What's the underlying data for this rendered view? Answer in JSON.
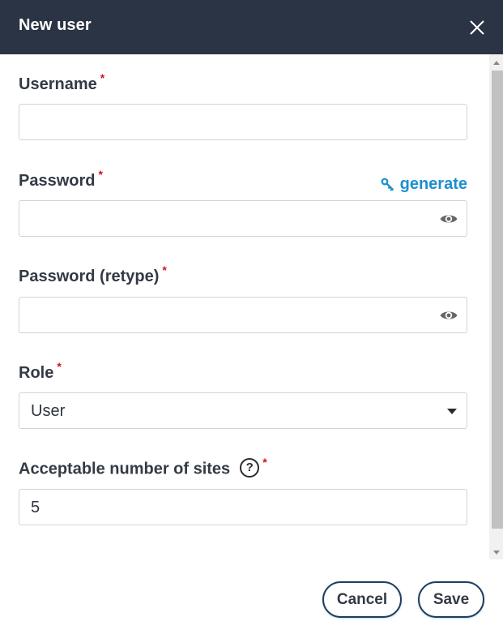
{
  "dialog": {
    "title": "New user",
    "close_icon": "close-icon"
  },
  "fields": {
    "username": {
      "label": "Username",
      "required": "*",
      "value": ""
    },
    "password": {
      "label": "Password",
      "required": "*",
      "value": "",
      "generate_label": "generate",
      "generate_icon": "key-icon",
      "toggle_icon": "eye-icon"
    },
    "password_retype": {
      "label": "Password (retype)",
      "required": "*",
      "value": "",
      "toggle_icon": "eye-icon"
    },
    "role": {
      "label": "Role",
      "required": "*",
      "value": "User"
    },
    "sites": {
      "label": "Acceptable number of sites",
      "required": "*",
      "help": "?",
      "value": "5"
    }
  },
  "actions": {
    "cancel_label": "Cancel",
    "save_label": "Save"
  },
  "colors": {
    "header_bg": "#2b3444",
    "accent": "#1d8fcf",
    "required": "#d0102a"
  }
}
